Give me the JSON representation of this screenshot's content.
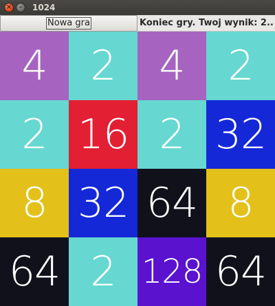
{
  "window": {
    "title": "1024",
    "close_glyph": "×",
    "minimize_glyph": "–"
  },
  "toolbar": {
    "new_game_label": "Nowa gra",
    "status_text": "Koniec gry. Twoj wynik: 2..."
  },
  "board": {
    "tiles": [
      {
        "value": "4",
        "color": "#a664c0"
      },
      {
        "value": "2",
        "color": "#66d7d1"
      },
      {
        "value": "4",
        "color": "#a664c0"
      },
      {
        "value": "2",
        "color": "#66d7d1"
      },
      {
        "value": "2",
        "color": "#66d7d1"
      },
      {
        "value": "16",
        "color": "#e21f33"
      },
      {
        "value": "2",
        "color": "#66d7d1"
      },
      {
        "value": "32",
        "color": "#1428d8"
      },
      {
        "value": "8",
        "color": "#e3c11a"
      },
      {
        "value": "32",
        "color": "#1428d8"
      },
      {
        "value": "64",
        "color": "#11111c"
      },
      {
        "value": "8",
        "color": "#e3c11a"
      },
      {
        "value": "64",
        "color": "#11111c"
      },
      {
        "value": "2",
        "color": "#66d7d1"
      },
      {
        "value": "128",
        "color": "#5a12cf"
      },
      {
        "value": "64",
        "color": "#11111c"
      }
    ]
  }
}
